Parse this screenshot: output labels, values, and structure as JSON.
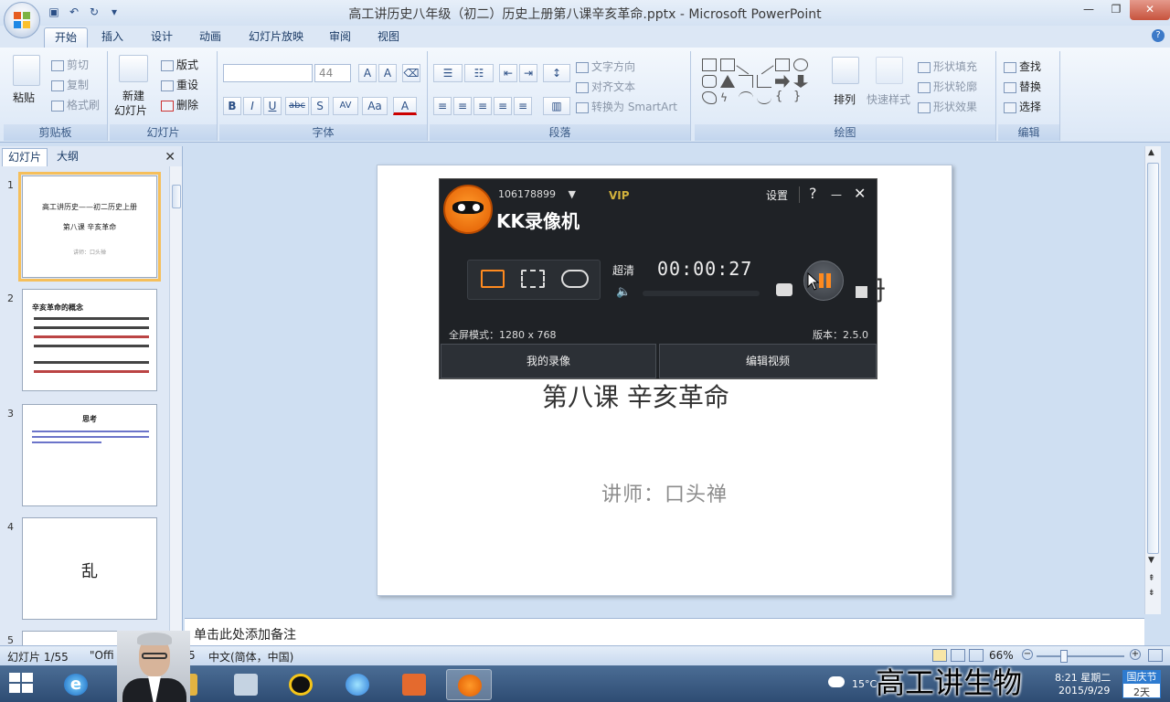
{
  "window": {
    "title": "高工讲历史八年级（初二）历史上册第八课辛亥革命.pptx - Microsoft PowerPoint",
    "controls": [
      "—",
      "❐",
      "✕"
    ]
  },
  "tabs": [
    "开始",
    "插入",
    "设计",
    "动画",
    "幻灯片放映",
    "审阅",
    "视图"
  ],
  "ribbon": {
    "clipboard": {
      "paste": "粘贴",
      "cut": "剪切",
      "copy": "复制",
      "format_painter": "格式刷",
      "label": "剪贴板"
    },
    "slides": {
      "new_slide": "新建",
      "new_slide2": "幻灯片",
      "layout": "版式",
      "reset": "重设",
      "delete": "删除",
      "label": "幻灯片"
    },
    "font": {
      "size": "44",
      "label": "字体",
      "bold": "B",
      "italic": "I",
      "underline": "U",
      "strike": "abc",
      "shadow": "S",
      "spacing": "AV",
      "case": "Aa",
      "color": "A",
      "grow": "A",
      "shrink": "A"
    },
    "paragraph": {
      "text_direction": "文字方向",
      "align_text": "对齐文本",
      "smartart": "转换为 SmartArt",
      "label": "段落"
    },
    "drawing": {
      "arrange": "排列",
      "quick_styles": "快速样式",
      "fill": "形状填充",
      "outline": "形状轮廓",
      "effects": "形状效果",
      "label": "绘图"
    },
    "editing": {
      "find": "查找",
      "replace": "替换",
      "select": "选择",
      "label": "编辑"
    }
  },
  "panel": {
    "tab_slides": "幻灯片",
    "tab_outline": "大纲",
    "close": "✕",
    "thumbs": [
      {
        "num": "1",
        "lines": [
          "高工讲历史——初二历史上册",
          "第八课 辛亥革命",
          "讲师：口头禅"
        ]
      },
      {
        "num": "2",
        "lines": [
          "辛亥革命的概念"
        ]
      },
      {
        "num": "3",
        "lines": [
          "思考"
        ]
      },
      {
        "num": "4",
        "lines": [
          "乱"
        ]
      },
      {
        "num": "5",
        "lines": []
      }
    ]
  },
  "slide": {
    "subtitle": "讲师：口头禅",
    "title_peek_right": "册",
    "title_peek_bottom": "第八课 辛亥革命"
  },
  "notes": {
    "placeholder": "单击此处添加备注"
  },
  "status": {
    "slide_count": "幻灯片 1/55",
    "theme": "\"Offi",
    "theme_tail": "5",
    "language": "中文(简体，中国)",
    "zoom": "66%"
  },
  "kk": {
    "account": "106178899",
    "vip": "VIP",
    "brand": "KK录像机",
    "settings": "设置",
    "help": "?",
    "minimize": "—",
    "close": "✕",
    "quality": "超清",
    "time": "00:00:27",
    "fullscreen_mode": "全屏模式：1280 x 768",
    "version": "版本：2.5.0",
    "my_recordings": "我的录像",
    "edit_video": "编辑视频"
  },
  "taskbar": {
    "temp": "15°C",
    "time": "8:21 星期二",
    "date": "2015/9/29",
    "holiday_top": "国庆节",
    "holiday_bottom": "2天"
  },
  "caption": "高工讲生物"
}
